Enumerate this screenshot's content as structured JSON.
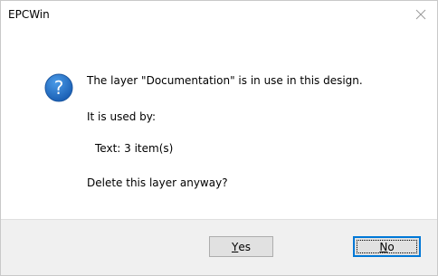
{
  "window": {
    "title": "EPCWin"
  },
  "dialog": {
    "icon": "question-icon",
    "message_line1": "The layer \"Documentation\" is in use in this design.",
    "message_line2": "It is used by:",
    "message_line3": "Text: 3 item(s)",
    "message_line4": "Delete this layer anyway?"
  },
  "buttons": {
    "yes_mnemonic": "Y",
    "yes_rest": "es",
    "no_mnemonic": "N",
    "no_rest": "o"
  },
  "colors": {
    "icon_blue": "#1a6fc9",
    "focus_border": "#0078d7",
    "footer_bg": "#f0f0f0"
  }
}
